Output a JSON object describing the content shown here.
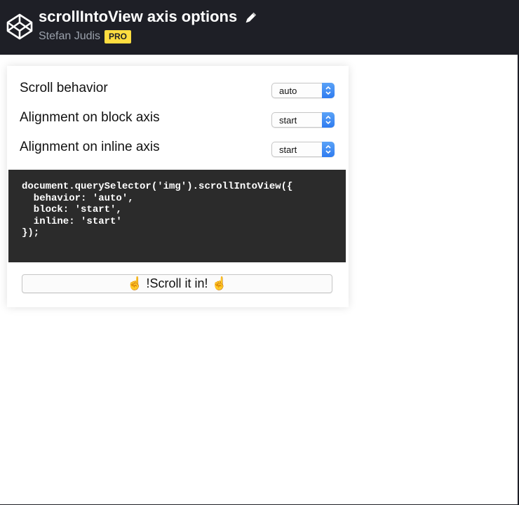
{
  "header": {
    "title": "scrollIntoView axis options",
    "author": "Stefan Judis",
    "badge": "PRO",
    "colors": {
      "bar": "#1e1f26",
      "badge": "#ffdd40"
    }
  },
  "form": {
    "scroll_behavior": {
      "label": "Scroll behavior",
      "value": "auto"
    },
    "block_alignment": {
      "label": "Alignment on block axis",
      "value": "start"
    },
    "inline_alignment": {
      "label": "Alignment on inline axis",
      "value": "start"
    }
  },
  "code": {
    "snippet": "document.querySelector('img').scrollIntoView({\n  behavior: 'auto',\n  block: 'start',\n  inline: 'start'\n});"
  },
  "action": {
    "button_label": "☝️ !Scroll it in! ☝️"
  },
  "icons": {
    "logo": "codepen-logo-icon",
    "edit": "pencil-icon",
    "select_arrows": "up-down-chevron-icon"
  }
}
